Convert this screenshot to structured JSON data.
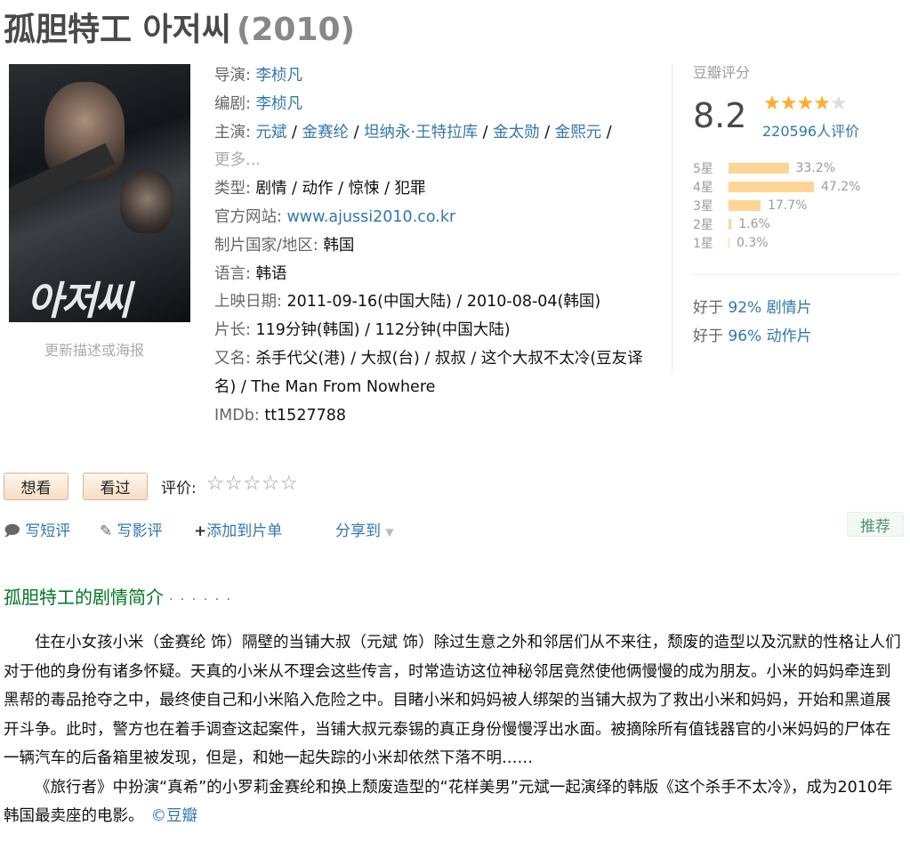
{
  "header": {
    "title": "孤胆特工 아저씨",
    "year": "(2010)"
  },
  "poster": {
    "overlay_text": "아저씨",
    "update_link": "更新描述或海报"
  },
  "info": {
    "director_label": "导演:",
    "director": "李桢凡",
    "writer_label": "编剧:",
    "writer": "李桢凡",
    "cast_label": "主演:",
    "cast": [
      "元斌",
      "金赛纶",
      "坦纳永·王特拉库",
      "金太勋",
      "金熙元"
    ],
    "cast_more": "更多...",
    "genre_label": "类型:",
    "genre": "剧情 / 动作 / 惊悚 / 犯罪",
    "website_label": "官方网站:",
    "website": "www.ajussi2010.co.kr",
    "country_label": "制片国家/地区:",
    "country": "韩国",
    "language_label": "语言:",
    "language": "韩语",
    "release_label": "上映日期:",
    "release": "2011-09-16(中国大陆) / 2010-08-04(韩国)",
    "runtime_label": "片长:",
    "runtime": "119分钟(韩国) / 112分钟(中国大陆)",
    "aka_label": "又名:",
    "aka": "杀手代父(港) / 大叔(台) / 叔叔 / 这个大叔不太冷(豆友译名) / The Man From Nowhere",
    "imdb_label": "IMDb:",
    "imdb": "tt1527788"
  },
  "rating": {
    "label": "豆瓣评分",
    "score": "8.2",
    "stars_filled": 4,
    "stars_total": 5,
    "votes": "220596人评价",
    "distribution": [
      {
        "label": "5星",
        "percent": "33.2%",
        "value": 33.2
      },
      {
        "label": "4星",
        "percent": "47.2%",
        "value": 47.2
      },
      {
        "label": "3星",
        "percent": "17.7%",
        "value": 17.7
      },
      {
        "label": "2星",
        "percent": "1.6%",
        "value": 1.6
      },
      {
        "label": "1星",
        "percent": "0.3%",
        "value": 0.3
      }
    ],
    "better_than": [
      {
        "prefix": "好于 ",
        "text": "92% 剧情片"
      },
      {
        "prefix": "好于 ",
        "text": "96% 动作片"
      }
    ]
  },
  "actions": {
    "want": "想看",
    "seen": "看过",
    "rate_label": "评价:",
    "rate_stars": "☆☆☆☆☆",
    "short_review": "写短评",
    "review": "写影评",
    "add_list": "添加到片单",
    "share": "分享到",
    "recommend": "推荐"
  },
  "summary": {
    "title": "孤胆特工的剧情简介",
    "dots": "· · · · · ·",
    "p1": "住在小女孩小米（金赛纶 饰）隔壁的当铺大叔（元斌 饰）除过生意之外和邻居们从不来往，颓废的造型以及沉默的性格让人们对于他的身份有诸多怀疑。天真的小米从不理会这些传言，时常造访这位神秘邻居竟然使他俩慢慢的成为朋友。小米的妈妈牵连到黑帮的毒品抢夺之中，最终使自己和小米陷入危险之中。目睹小米和妈妈被人绑架的当铺大叔为了救出小米和妈妈，开始和黑道展开斗争。此时，警方也在着手调查这起案件，当铺大叔元泰锡的真正身份慢慢浮出水面。被摘除所有值钱器官的小米妈妈的尸体在一辆汽车的后备箱里被发现，但是，和她一起失踪的小米却依然下落不明……",
    "p2": "《旅行者》中扮演“真希”的小罗莉金赛纶和换上颓废造型的“花样美男”元斌一起演绎的韩版《这个杀手不太冷》，成为2010年韩国最卖座的电影。",
    "copyright": "©豆瓣"
  }
}
